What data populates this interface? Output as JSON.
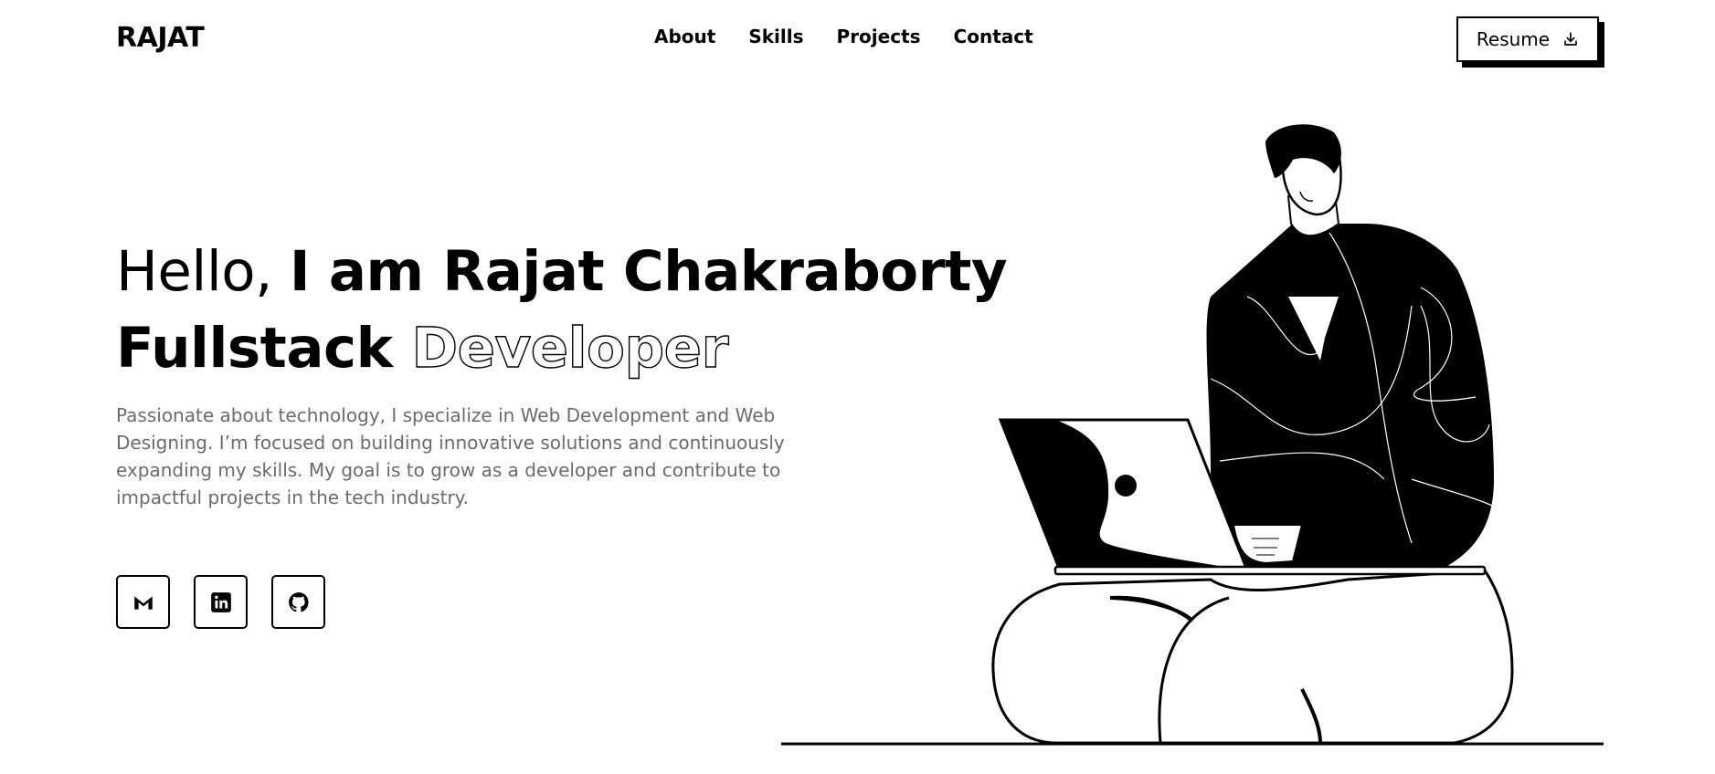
{
  "header": {
    "logo": "RAJAT",
    "nav": [
      "About",
      "Skills",
      "Projects",
      "Contact"
    ],
    "resume_label": "Resume"
  },
  "hero": {
    "greeting": "Hello,",
    "name_line": "I am Rajat Chakraborty",
    "role_solid": "Fullstack",
    "role_outline": "Developer",
    "description": "Passionate about technology, I specialize in Web Development and Web Designing. I’m focused on building innovative solutions and continuously expanding my skills. My goal is to grow as a developer and contribute to impactful projects in the tech industry."
  },
  "socials": [
    {
      "icon": "gmail-icon"
    },
    {
      "icon": "linkedin-icon"
    },
    {
      "icon": "github-icon"
    }
  ],
  "colors": {
    "text": "#000000",
    "muted": "#6b6b6b",
    "background": "#ffffff"
  }
}
